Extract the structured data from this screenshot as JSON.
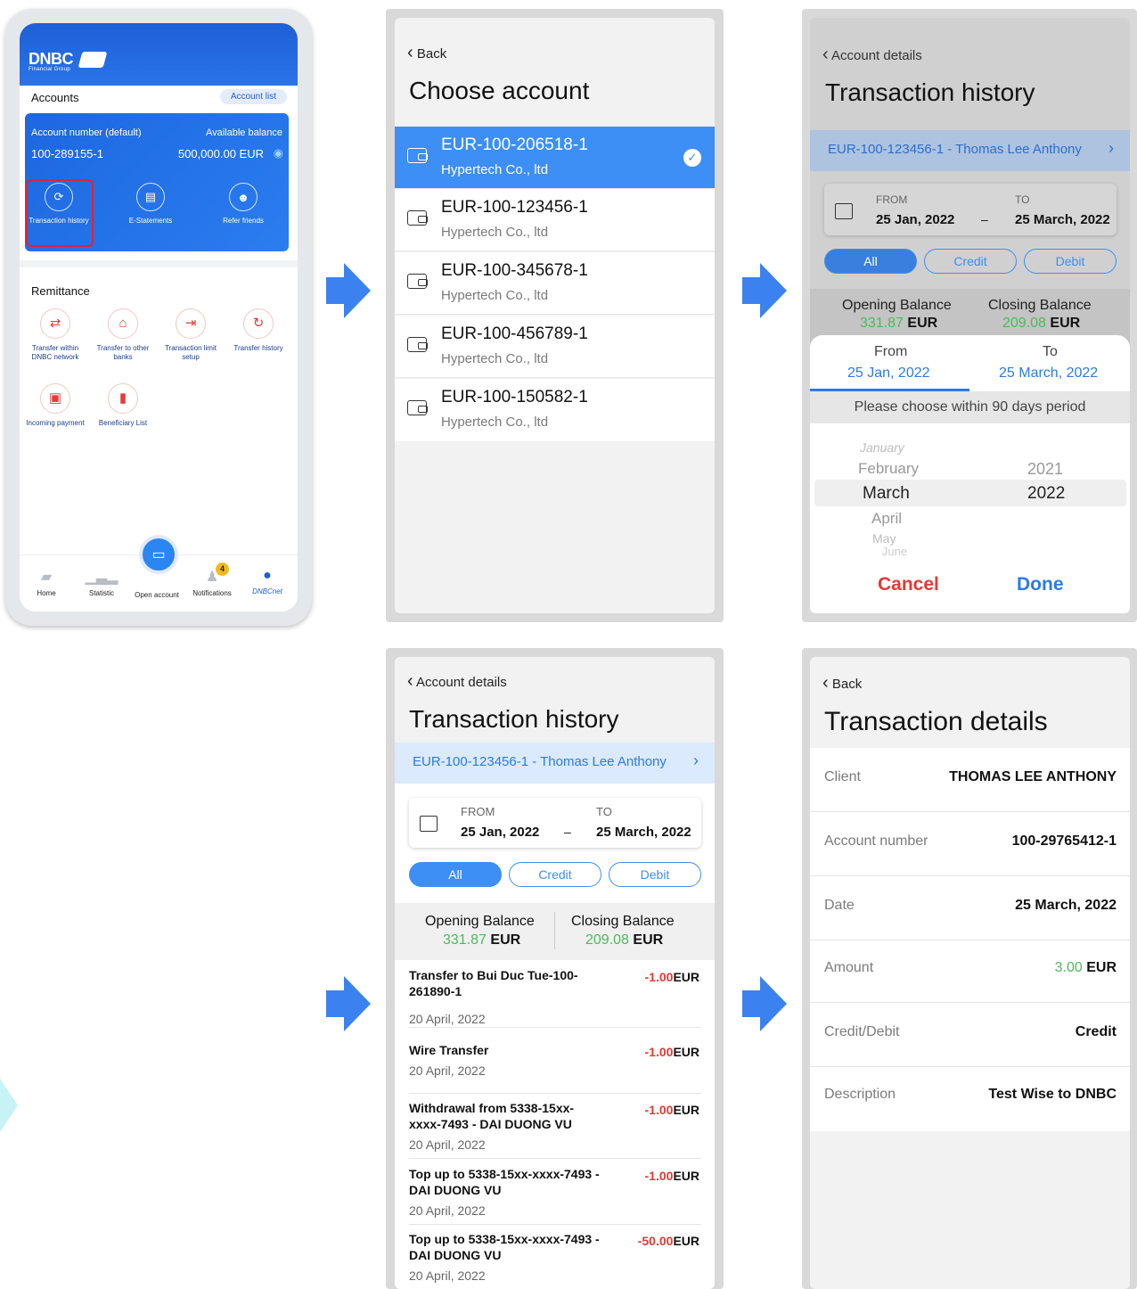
{
  "home": {
    "logo": "DNBC",
    "logo_sub": "Financial Group",
    "accounts_label": "Accounts",
    "account_list": "Account list",
    "account_number_label": "Account number (default)",
    "available_balance_label": "Available balance",
    "account_number": "100-289155-1",
    "balance": "500,000.00 EUR",
    "shortcuts": [
      "Transaction history",
      "E-Statements",
      "Refer friends"
    ],
    "remittance_label": "Remittance",
    "remittance": [
      "Transfer within DNBC network",
      "Transfer to other banks",
      "Transaction limit setup",
      "Transfer history",
      "Incoming payment",
      "Beneficiary List"
    ],
    "tabs": [
      "Home",
      "Statistic",
      "Open account",
      "Notifications",
      "DNBCnet"
    ],
    "notif_count": "4",
    "colors": {
      "primary": "#1e5fd6",
      "highlight": "#e8202a"
    }
  },
  "choose": {
    "back": "Back",
    "title": "Choose account",
    "accounts": [
      {
        "num": "EUR-100-206518-1",
        "co": "Hypertech Co., ltd"
      },
      {
        "num": "EUR-100-123456-1",
        "co": "Hypertech Co., ltd"
      },
      {
        "num": "EUR-100-345678-1",
        "co": "Hypertech Co., ltd"
      },
      {
        "num": "EUR-100-456789-1",
        "co": "Hypertech Co., ltd"
      },
      {
        "num": "EUR-100-150582-1",
        "co": "Hypertech Co., ltd"
      }
    ]
  },
  "history": {
    "back": "Account details",
    "title": "Transaction history",
    "account": "EUR-100-123456-1 - Thomas Lee Anthony",
    "from_label": "FROM",
    "to_label": "TO",
    "from": "25 Jan, 2022",
    "to": "25 March, 2022",
    "dash": "–",
    "filters": [
      "All",
      "Credit",
      "Debit"
    ],
    "opening_label": "Opening Balance",
    "closing_label": "Closing Balance",
    "opening": "331.87",
    "closing": "209.08",
    "currency": "EUR",
    "transactions": [
      {
        "title": "Transfer to Bui Duc Tue-100-261890-1",
        "amount": "-1.00",
        "date": "20 April, 2022"
      },
      {
        "title": "Wire Transfer",
        "amount": "-1.00",
        "date": "20 April, 2022"
      },
      {
        "title": "Withdrawal from 5338-15xx-xxxx-7493 - DAI DUONG VU",
        "amount": "-1.00",
        "date": "20 April, 2022"
      },
      {
        "title": "Top up to 5338-15xx-xxxx-7493 - DAI DUONG VU",
        "amount": "-1.00",
        "date": "20 April, 2022"
      },
      {
        "title": "Top up to 5338-15xx-xxxx-7493 - DAI DUONG VU",
        "amount": "-50.00",
        "date": "20 April, 2022"
      }
    ]
  },
  "picker": {
    "from_label": "From",
    "to_label": "To",
    "from": "25 Jan, 2022",
    "to": "25 March, 2022",
    "hint": "Please choose within 90 days period",
    "months": [
      "January",
      "February",
      "March",
      "April",
      "May",
      "June"
    ],
    "years": [
      "2021",
      "2022"
    ],
    "cancel": "Cancel",
    "done": "Done"
  },
  "details": {
    "back": "Back",
    "title": "Transaction details",
    "rows": [
      {
        "k": "Client",
        "v": "THOMAS LEE ANTHONY"
      },
      {
        "k": "Account number",
        "v": "100-29765412-1"
      },
      {
        "k": "Date",
        "v": "25 March, 2022"
      },
      {
        "k": "Amount",
        "v": "3.00",
        "cur": "EUR"
      },
      {
        "k": "Credit/Debit",
        "v": "Credit"
      },
      {
        "k": "Description",
        "v": "Test Wise to DNBC"
      }
    ]
  }
}
